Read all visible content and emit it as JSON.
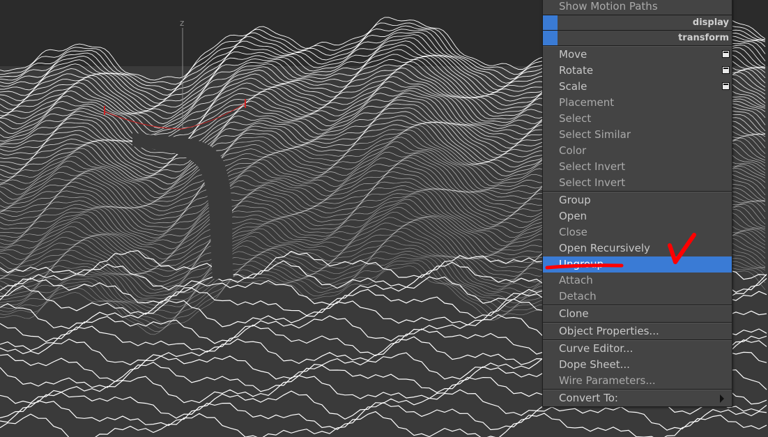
{
  "viewport": {
    "axis_label": "z",
    "background_color": "#3a3a3a",
    "contour_color": "#ffffff",
    "gizmo_color": "#cc2222"
  },
  "quad_menu": {
    "accent_color": "#3a7bd5",
    "top_item": "Show Motion Paths",
    "sections": [
      {
        "label": "display"
      },
      {
        "label": "transform"
      }
    ],
    "transform_items": [
      {
        "label": "Move",
        "has_options": true
      },
      {
        "label": "Rotate",
        "has_options": true
      },
      {
        "label": "Scale",
        "has_options": true
      },
      {
        "label": "Placement"
      },
      {
        "label": "Select"
      },
      {
        "label": "Select Similar"
      },
      {
        "label": "Color"
      },
      {
        "label": "Select Invert"
      },
      {
        "label": "Select Invert"
      }
    ],
    "group_items": [
      {
        "label": "Group"
      },
      {
        "label": "Open"
      },
      {
        "label": "Close"
      },
      {
        "label": "Open Recursively"
      },
      {
        "label": "Ungroup",
        "highlighted": true
      },
      {
        "label": "Attach"
      },
      {
        "label": "Detach"
      }
    ],
    "clone_item": "Clone",
    "object_properties_item": "Object Properties...",
    "editor_items": [
      {
        "label": "Curve Editor..."
      },
      {
        "label": "Dope Sheet..."
      },
      {
        "label": "Wire Parameters..."
      }
    ],
    "convert_item": "Convert To:"
  },
  "annotations": {
    "stroke_color": "#ff0000",
    "marks": [
      "underline",
      "checkmark"
    ]
  }
}
